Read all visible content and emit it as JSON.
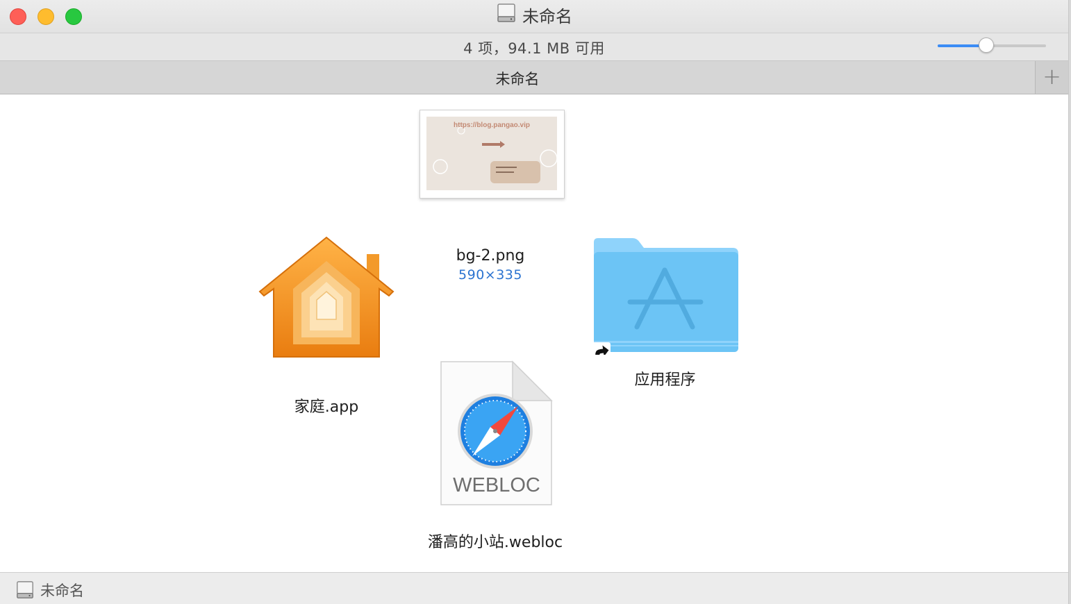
{
  "window": {
    "title": "未命名",
    "status": "4 项，94.1 MB 可用",
    "zoom_level": 0.45
  },
  "tabbar": {
    "tab_label": "未命名",
    "add_symbol": "+"
  },
  "items": {
    "image": {
      "name": "bg-2.png",
      "dims": "590×335",
      "preview_url_text": "https://blog.pangao.vip"
    },
    "home_app": {
      "name": "家庭.app"
    },
    "applications": {
      "name": "应用程序"
    },
    "webloc": {
      "name": "潘高的小站.webloc",
      "badge": "WEBLOC"
    }
  },
  "pathbar": {
    "label": "未命名"
  },
  "colors": {
    "accent": "#3b8cf5",
    "folder": "#6cc4f5",
    "home_orange": "#f28c1c",
    "dims_blue": "#2b73d0"
  }
}
